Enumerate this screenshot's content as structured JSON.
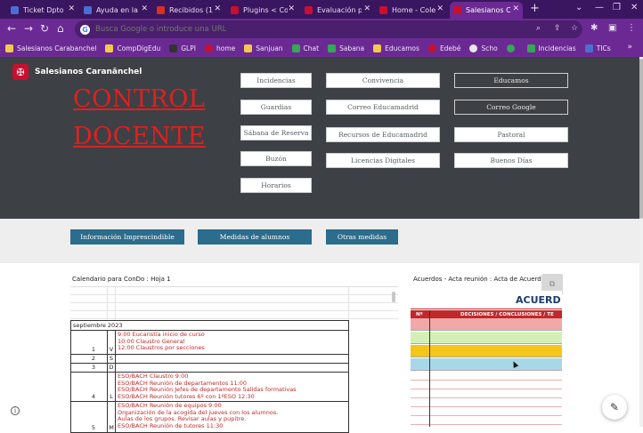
{
  "browser": {
    "tabs": [
      {
        "title": "Ticket Dpto",
        "color": "#4a6fd1"
      },
      {
        "title": "Ayuda en la",
        "color": "#4a6fd1"
      },
      {
        "title": "Recibidos (1",
        "color": "#d93025"
      },
      {
        "title": "Plugins < Co",
        "color": "#c8102e"
      },
      {
        "title": "Evaluación p",
        "color": "#c8102e"
      },
      {
        "title": "Home - Cole",
        "color": "#c8102e"
      },
      {
        "title": "Salesianos C",
        "color": "#c8102e"
      }
    ],
    "new_tab": "+",
    "address_placeholder": "Busca Google o introduce una URL",
    "bookmarks": [
      {
        "label": "Salesianos Carabanchel",
        "color": "#f2c94c"
      },
      {
        "label": "CompDigEdu",
        "color": "#f2c94c"
      },
      {
        "label": "GLPI",
        "color": "#333333"
      },
      {
        "label": "home",
        "color": "#c8102e"
      },
      {
        "label": "Sanjuan",
        "color": "#f2c94c"
      },
      {
        "label": "Chat",
        "color": "#34a853"
      },
      {
        "label": "Sabana",
        "color": "#34a853"
      },
      {
        "label": "Educamos",
        "color": "#f2c94c"
      },
      {
        "label": "Edebé",
        "color": "#c8102e"
      },
      {
        "label": "Scho",
        "color": "#e8e8e8"
      },
      {
        "label": "",
        "color": "#34a853"
      },
      {
        "label": "Incidencias",
        "color": "#34a853"
      },
      {
        "label": "TICs",
        "color": "#4a6fd1"
      }
    ]
  },
  "site": {
    "brand": "Salesianos Caranänchel",
    "title_line1": "CONTROL",
    "title_line2": "DOCENTE",
    "buttons_col1": [
      "Incidencias",
      "Guardias",
      "Sábana de Reserva",
      "Buzón",
      "Horarios"
    ],
    "buttons_col2": [
      "Convivencia",
      "Correo Educamadrid",
      "Recursos de Educamadrid",
      "Licencias Digitales"
    ],
    "buttons_col3": [
      "Educamos",
      "Correo Google",
      "Pastoral",
      "Buenos Días"
    ],
    "strip_buttons": [
      "Información Imprescindible",
      "Medidas de alumnos",
      "Otras medidas"
    ]
  },
  "calendar": {
    "panel_title": "Calendario para ConDo : Hoja 1",
    "month": "septiembre 2023",
    "rows": [
      {
        "day": "1",
        "letter": "V",
        "events": [
          "9:00 Eucaristía inicio de curso",
          "10:00 Claustro General",
          "12:00 Claustros por secciones"
        ]
      },
      {
        "day": "2",
        "letter": "S",
        "events": []
      },
      {
        "day": "3",
        "letter": "D",
        "events": []
      },
      {
        "day": "4",
        "letter": "L",
        "events": [
          "ESO/BACH Claustro 9:00",
          "ESO/BACH Reunión de departamentos 11:00",
          "ESO/BACH Reunión Jefes de departamento Salidas formativas",
          "ESO/BACH Reunión tutores 6º con 1ºESO 12:30"
        ]
      },
      {
        "day": "5",
        "letter": "M",
        "events": [
          "ESO/BACH Reunión de equipos 9:00",
          "Organización de la acogida del jueves con los alumnos.",
          "Aulas de los grupos. Revisar aulas y pupitre.",
          "ESO/BACH Reunión de tutores 11:30"
        ]
      }
    ]
  },
  "acta": {
    "panel_title": "Acuerdos - Acta reunión : Acta de Acuerdos",
    "heading": "ACUERD",
    "col_num": "Nº",
    "col_decisions": "DECISIONES / CONCLUSIONES / TE",
    "row_colors": [
      "#f0a8a8",
      "#d4f0b8",
      "#f5c518",
      "#a8d8e8"
    ]
  }
}
